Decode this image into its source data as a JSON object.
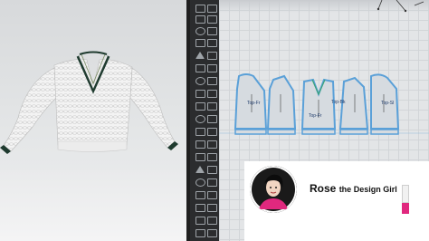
{
  "branding": {
    "name_first": "Rose",
    "name_rest": "the Design Girl",
    "accent": "#e0287e"
  },
  "pattern": {
    "piece_labels": [
      "Top-Fr",
      "Top-Fr",
      "Top-Bk",
      "Top-Sl"
    ]
  },
  "colors": {
    "viewport_bg": "#dfe1e3",
    "toolbar_bg": "#2b2c2e",
    "pattern_bg": "#e3e5e7",
    "pattern_outline": "#5aa0d8",
    "sweater": "#f2f2f2",
    "trim": "#1f3b2f"
  },
  "icons": [
    "move-icon",
    "select-icon",
    "edit-pattern-icon",
    "pen-icon",
    "arrow-cursor-icon"
  ]
}
